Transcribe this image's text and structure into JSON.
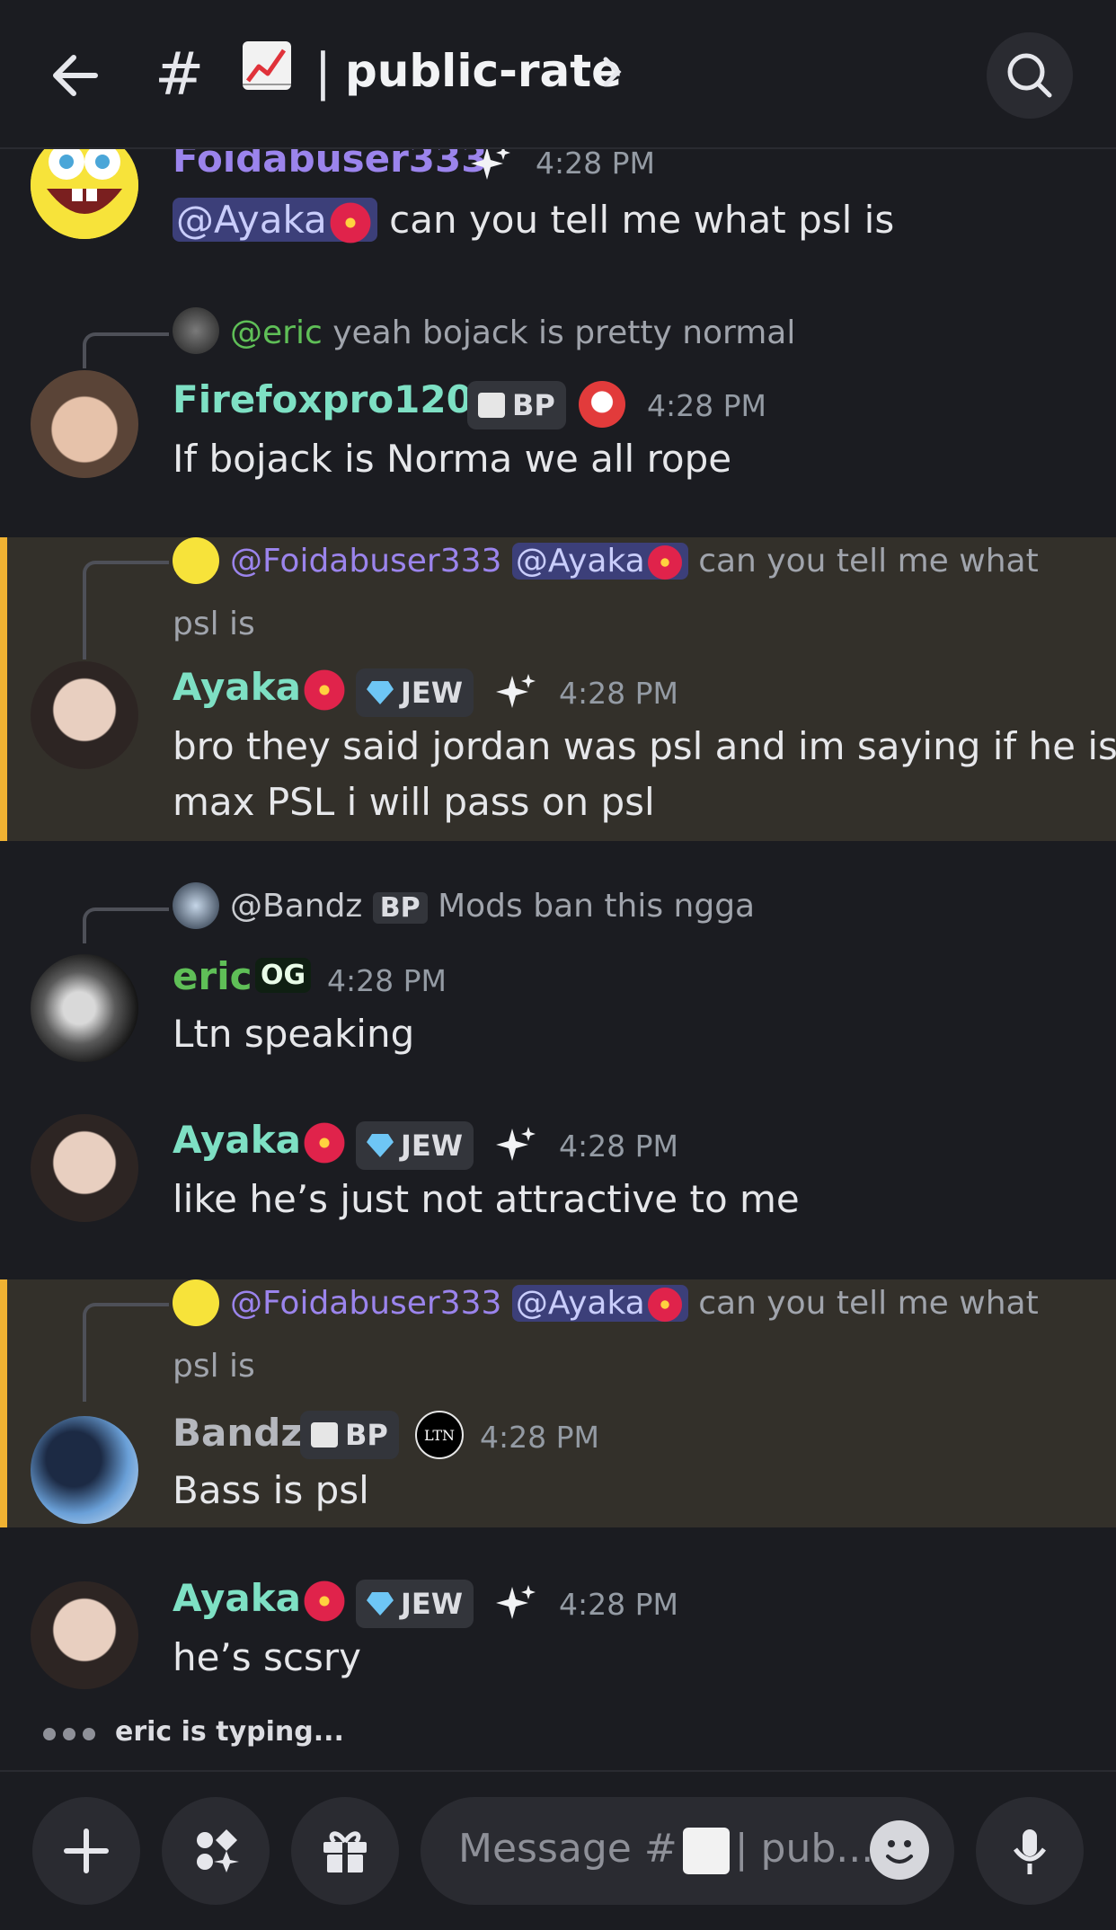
{
  "header": {
    "hash": "#",
    "channel_emoji": "chart-increasing-icon",
    "separator": "|",
    "channel_name": "public-rate"
  },
  "messages": [
    {
      "username": "Foidabuser333",
      "time": "4:28 PM",
      "mention": "@Ayaka",
      "text": "can you tell me what psl is"
    },
    {
      "reply_to": "@eric",
      "reply_text": "yeah bojack is pretty normal",
      "username": "Firefoxpro1209",
      "badge": "BP",
      "time": "4:28 PM",
      "text": "If bojack is Norma we all rope"
    },
    {
      "reply_to": "@Foidabuser333",
      "reply_mention": "@Ayaka",
      "reply_text_1": "can you tell me what",
      "reply_text_2": "psl is",
      "username": "Ayaka",
      "badge": "JEW",
      "time": "4:28 PM",
      "text_1": "bro they said jordan was psl and im saying if he is",
      "text_2": "max PSL i will pass on psl"
    },
    {
      "reply_to": "@Bandz",
      "reply_badge": "BP",
      "reply_text": "Mods ban this ngga",
      "username": "eric",
      "badge": "OG",
      "time": "4:28 PM",
      "text": "Ltn speaking"
    },
    {
      "username": "Ayaka",
      "badge": "JEW",
      "time": "4:28 PM",
      "text": "like he’s just not attractive to me"
    },
    {
      "reply_to": "@Foidabuser333",
      "reply_mention": "@Ayaka",
      "reply_text_1": "can you tell me what",
      "reply_text_2": "psl is",
      "username": "Bandz",
      "badge": "BP",
      "badge2": "LTN",
      "time": "4:28 PM",
      "text": "Bass is psl"
    },
    {
      "username": "Ayaka",
      "badge": "JEW",
      "time": "4:28 PM",
      "text": "he’s scsry"
    }
  ],
  "typing": "eric is typing...",
  "composer": {
    "placeholder": "Message #",
    "placeholder_tail": "| pub..."
  },
  "colors": {
    "background": "#1b1c21",
    "highlight": "#33302a",
    "highlight_bar": "#f0b232",
    "name_purple": "#9b84ec",
    "name_teal": "#7ee0c4",
    "name_green": "#5fbf57"
  }
}
